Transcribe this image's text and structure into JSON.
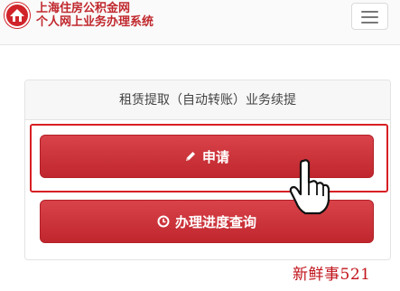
{
  "header": {
    "brand_line1": "上海住房公积金网",
    "brand_line2": "个人网上业务办理系统",
    "logo_icon": "housing-fund-logo-icon",
    "menu_icon": "hamburger-menu-icon"
  },
  "panel": {
    "title": "租赁提取（自动转账）业务续提",
    "apply_label": "申请",
    "apply_icon": "pencil-icon",
    "progress_label": "办理进度查询",
    "progress_icon": "clock-icon"
  },
  "watermark": "新鲜事521",
  "colors": {
    "accent": "#c9313a",
    "brand": "#c0282d",
    "highlight": "#d81f24"
  }
}
